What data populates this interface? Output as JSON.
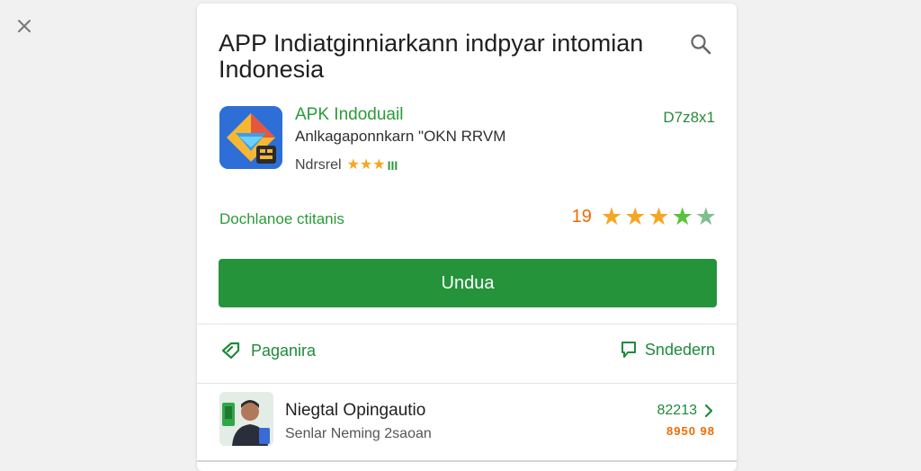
{
  "header": {
    "title": "APP Indiatginniarkann indpyar intomian Indonesia"
  },
  "icons": {
    "close": "close-icon",
    "search": "search-icon",
    "share": "share-icon",
    "review": "chat-icon",
    "chevron": "chevron-right-icon"
  },
  "app": {
    "name": "APK Indoduail",
    "subtitle": "Anlkagaponnkarn \"OKN RRVM",
    "meta_label": "Ndrsrel",
    "stars_count": 3,
    "badge": "III",
    "code": "D7z8x1"
  },
  "download_row": {
    "label": "Dochlanoe ctitanis",
    "rating_number": "19",
    "stars": [
      "full",
      "full",
      "full",
      "green",
      "muted"
    ]
  },
  "install_button": {
    "label": "Undua"
  },
  "actions": {
    "share_label": "Paganira",
    "review_label": "Sndedern"
  },
  "related": {
    "title": "Niegtal Opingautio",
    "subtitle": "Senlar Neming 2saoan",
    "code": "82213",
    "price": "8950 98"
  },
  "colors": {
    "accent_green": "#25933a",
    "text_green": "#2a9a3a",
    "orange": "#f06a00",
    "star_orange": "#f5a623",
    "star_green": "#59c23a",
    "star_muted": "#7fbf8f"
  }
}
